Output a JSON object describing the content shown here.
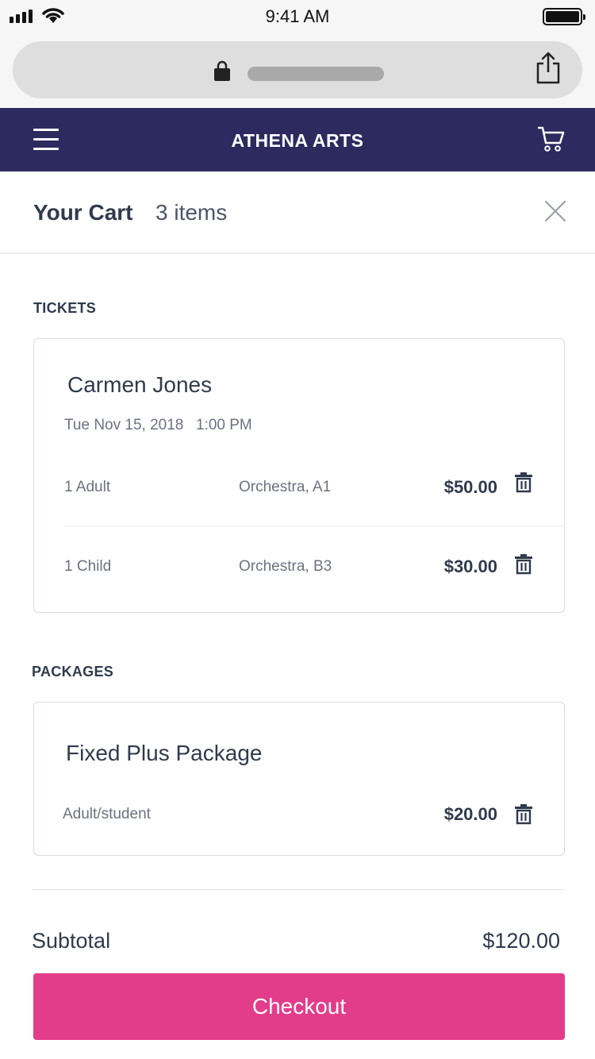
{
  "status_bar": {
    "time": "9:41 AM"
  },
  "header": {
    "brand": "ATHENA ARTS",
    "menu_icon": "hamburger-menu-icon",
    "cart_icon": "shopping-cart-icon",
    "background": "#2d2a5f"
  },
  "cart": {
    "title": "Your Cart",
    "count_text": "3 items",
    "close_icon": "close-icon"
  },
  "tickets": {
    "label": "TICKETS",
    "event": {
      "title": "Carmen Jones",
      "date": "Tue Nov 15, 2018",
      "time": "1:00 PM",
      "lines": [
        {
          "qty": "1 Adult",
          "seat": "Orchestra, A1",
          "price": "$50.00"
        },
        {
          "qty": "1 Child",
          "seat": "Orchestra, B3",
          "price": "$30.00"
        }
      ]
    }
  },
  "packages": {
    "label": "PACKAGES",
    "item": {
      "title": "Fixed Plus Package",
      "type": "Adult/student",
      "price": "$20.00"
    }
  },
  "summary": {
    "subtotal_label": "Subtotal",
    "subtotal_value": "$120.00"
  },
  "checkout": {
    "label": "Checkout",
    "color": "#e33c8a"
  }
}
